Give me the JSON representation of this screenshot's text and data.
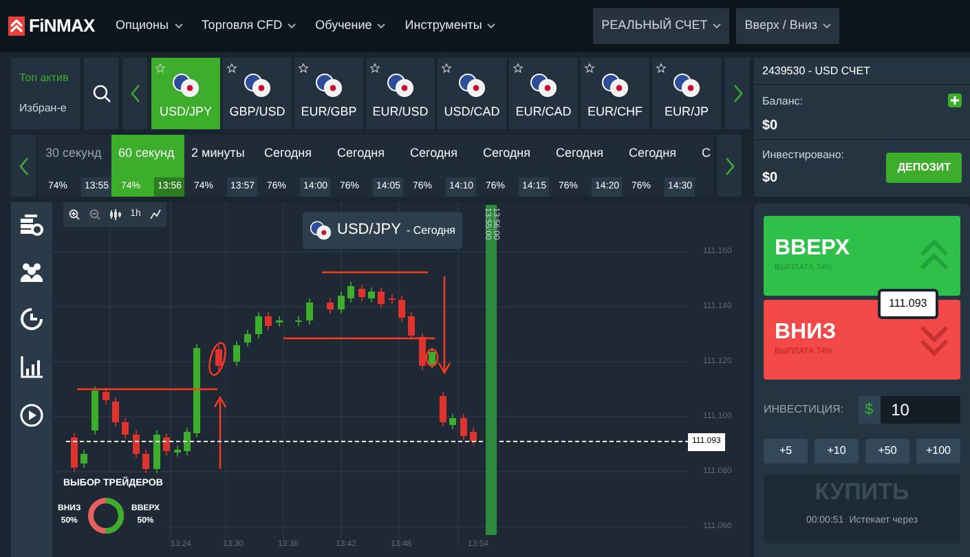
{
  "header": {
    "logo": "FiNMAX",
    "menu": [
      {
        "label": "Опционы"
      },
      {
        "label": "Торговля CFD"
      },
      {
        "label": "Обучение"
      },
      {
        "label": "Инструменты"
      }
    ],
    "account_button": "РЕАЛЬНЫЙ СЧЕТ",
    "mode_button": "Вверх / Вниз"
  },
  "asset_filters": [
    {
      "label": "Топ актив",
      "selected": true
    },
    {
      "label": "Избран-е",
      "selected": false
    }
  ],
  "assets": [
    {
      "label": "USD/JPY",
      "selected": true
    },
    {
      "label": "GBP/USD",
      "selected": false
    },
    {
      "label": "EUR/GBP",
      "selected": false
    },
    {
      "label": "EUR/USD",
      "selected": false
    },
    {
      "label": "USD/CAD",
      "selected": false
    },
    {
      "label": "EUR/CAD",
      "selected": false
    },
    {
      "label": "EUR/CHF",
      "selected": false
    },
    {
      "label": "EUR/JP",
      "selected": false
    }
  ],
  "expiries": [
    {
      "label": "30 секунд",
      "payout": "74%",
      "time": "13:55",
      "selected": false
    },
    {
      "label": "60 секунд",
      "payout": "74%",
      "time": "13:56",
      "selected": true
    },
    {
      "label": "2 минуты",
      "payout": "74%",
      "time": "13:57",
      "selected": false
    },
    {
      "label": "Сегодня",
      "payout": "76%",
      "time": "14:00",
      "selected": false
    },
    {
      "label": "Сегодня",
      "payout": "76%",
      "time": "14:05",
      "selected": false
    },
    {
      "label": "Сегодня",
      "payout": "76%",
      "time": "14:10",
      "selected": false
    },
    {
      "label": "Сегодня",
      "payout": "76%",
      "time": "14:15",
      "selected": false
    },
    {
      "label": "Сегодня",
      "payout": "76%",
      "time": "14:20",
      "selected": false
    },
    {
      "label": "Сегодня",
      "payout": "76%",
      "time": "14:30",
      "selected": false
    },
    {
      "label": "С",
      "selected": false
    }
  ],
  "chart": {
    "title": "USD/JPY",
    "subtitle": "- Сегодня",
    "tools": [
      "1h"
    ],
    "y_labels": [
      "111.160",
      "111.140",
      "111.120",
      "111.100",
      "111.080",
      "111.060"
    ],
    "x_labels": [
      "13:24",
      "13:30",
      "13:36",
      "13:42",
      "13:48",
      "13:54"
    ],
    "expiry_labels": [
      "13:56:00",
      "13:55:00"
    ],
    "current_price": "111.093"
  },
  "traders_choice": {
    "title": "ВЫБОР ТРЕЙДЕРОВ",
    "down_label": "ВНИЗ",
    "down_share": "50%",
    "up_label": "ВВЕРХ",
    "up_share": "50%",
    "level": 0.5
  },
  "account": {
    "title": "2439530 - USD СЧЕТ",
    "balance_label": "Баланс:",
    "balance": "$0",
    "invested_label": "Инвестировано:",
    "invested": "$0",
    "deposit_button": "ДЕПОЗИТ"
  },
  "trade": {
    "up_button": "ВВЕРХ",
    "up_payout": "ВЫПЛАТА 74%",
    "down_button": "ВНИЗ",
    "down_payout": "ВЫПЛАТА 74%",
    "price": "111.093",
    "investment_label": "ИНВЕСТИЦИЯ:",
    "currency": "$",
    "amount": "10",
    "increments": [
      "+5",
      "+10",
      "+50",
      "+100"
    ],
    "buy_button": "КУПИТЬ",
    "timer": "00:00:51",
    "timer_label": "Истекает через"
  }
}
